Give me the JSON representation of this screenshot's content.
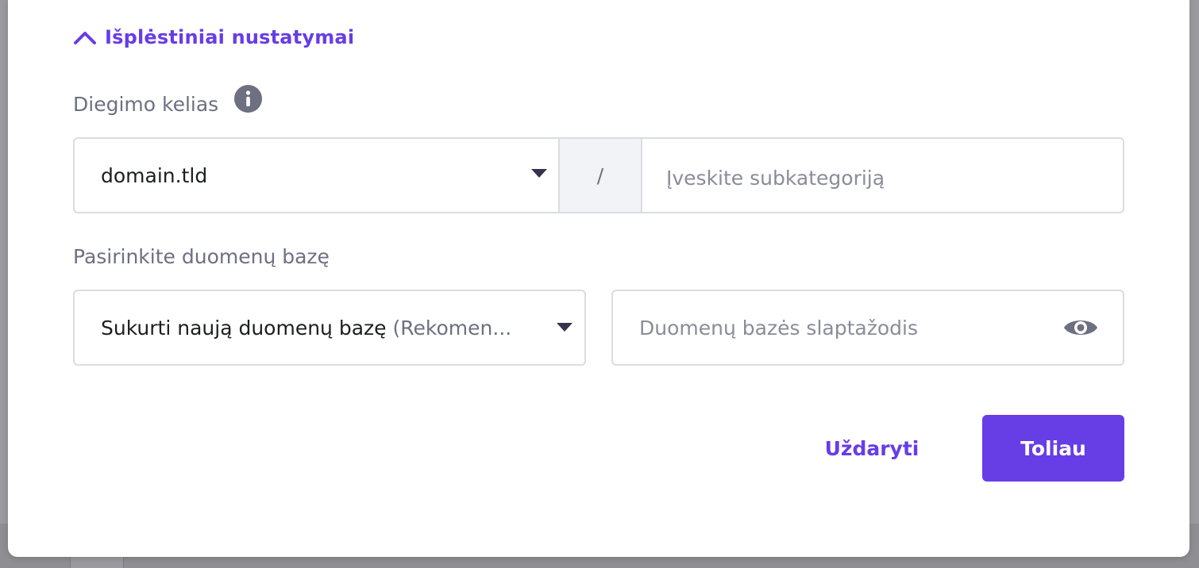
{
  "advanced": {
    "toggle_label": "Išplėstiniai nustatymai",
    "expanded": true
  },
  "install_path": {
    "label": "Diegimo kelias",
    "domain_value": "domain.tld",
    "separator": "/",
    "subdirectory_placeholder": "Įveskite subkategoriją"
  },
  "database": {
    "label": "Pasirinkite duomenų bazę",
    "selected": "Sukurti naują duomenų bazę",
    "selected_hint": "(Rekomen...",
    "password_placeholder": "Duomenų bazės slaptažodis"
  },
  "actions": {
    "close_label": "Uždaryti",
    "next_label": "Toliau"
  },
  "colors": {
    "accent": "#673de6",
    "label_text": "#6d7081",
    "border": "#dadce0"
  },
  "icons": {
    "toggle": "chevron-up-icon",
    "info": "info-icon",
    "select_arrow": "caret-down-icon",
    "password_visibility": "eye-icon"
  }
}
